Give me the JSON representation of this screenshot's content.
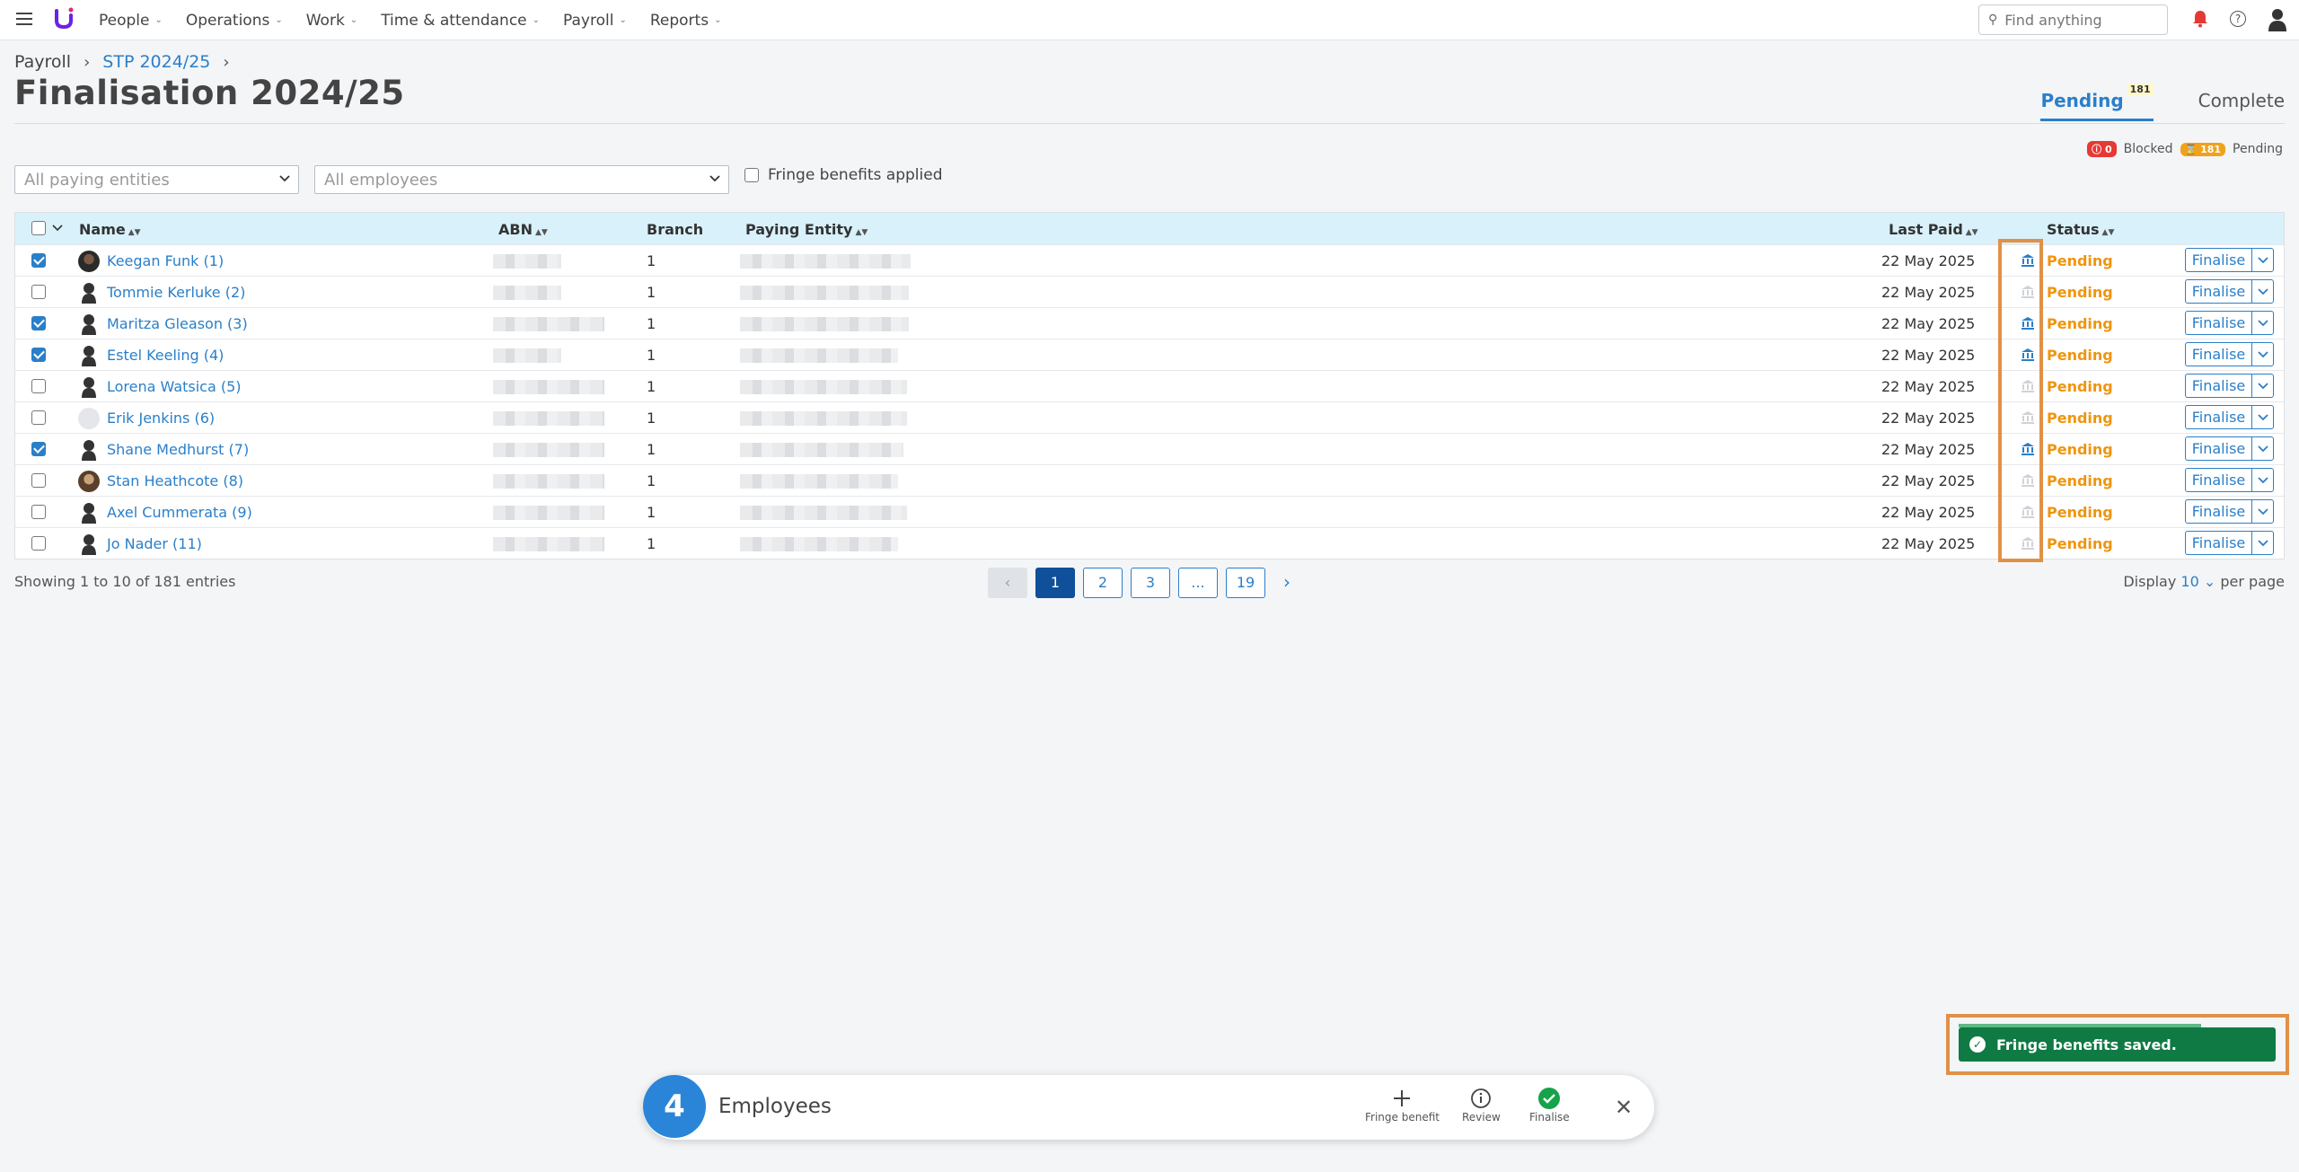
{
  "nav": {
    "items": [
      "People",
      "Operations",
      "Work",
      "Time & attendance",
      "Payroll",
      "Reports"
    ],
    "search_placeholder": "Find anything"
  },
  "breadcrumb": {
    "root": "Payroll",
    "current": "STP 2024/25"
  },
  "page_title": "Finalisation 2024/25",
  "tabs": [
    {
      "label": "Pending",
      "count": "181"
    },
    {
      "label": "Complete"
    }
  ],
  "legend": {
    "blocked_count": "0",
    "blocked_label": "Blocked",
    "pending_count": "181",
    "pending_label": "Pending"
  },
  "filters": {
    "entities_placeholder": "All paying entities",
    "employees_placeholder": "All employees",
    "fringe_label": "Fringe benefits applied"
  },
  "table": {
    "headers": {
      "name": "Name",
      "abn": "ABN",
      "branch": "Branch",
      "entity": "Paying Entity",
      "last_paid": "Last Paid",
      "status": "Status"
    },
    "rows": [
      {
        "name": "Keegan Funk (1)",
        "branch": "1",
        "last_paid": "22 May 2025",
        "status": "Pending",
        "checked": true,
        "fringe": true,
        "avatar": "photo"
      },
      {
        "name": "Tommie Kerluke (2)",
        "branch": "1",
        "last_paid": "22 May 2025",
        "status": "Pending",
        "checked": false,
        "fringe": false,
        "avatar": "silhouette"
      },
      {
        "name": "Maritza Gleason (3)",
        "branch": "1",
        "last_paid": "22 May 2025",
        "status": "Pending",
        "checked": true,
        "fringe": true,
        "avatar": "silhouette"
      },
      {
        "name": "Estel Keeling (4)",
        "branch": "1",
        "last_paid": "22 May 2025",
        "status": "Pending",
        "checked": true,
        "fringe": true,
        "avatar": "silhouette"
      },
      {
        "name": "Lorena Watsica (5)",
        "branch": "1",
        "last_paid": "22 May 2025",
        "status": "Pending",
        "checked": false,
        "fringe": false,
        "avatar": "silhouette"
      },
      {
        "name": "Erik Jenkins (6)",
        "branch": "1",
        "last_paid": "22 May 2025",
        "status": "Pending",
        "checked": false,
        "fringe": false,
        "avatar": "blank"
      },
      {
        "name": "Shane Medhurst (7)",
        "branch": "1",
        "last_paid": "22 May 2025",
        "status": "Pending",
        "checked": true,
        "fringe": true,
        "avatar": "silhouette"
      },
      {
        "name": "Stan Heathcote (8)",
        "branch": "1",
        "last_paid": "22 May 2025",
        "status": "Pending",
        "checked": false,
        "fringe": false,
        "avatar": "photo2"
      },
      {
        "name": "Axel Cummerata (9)",
        "branch": "1",
        "last_paid": "22 May 2025",
        "status": "Pending",
        "checked": false,
        "fringe": false,
        "avatar": "silhouette"
      },
      {
        "name": "Jo Nader (11)",
        "branch": "1",
        "last_paid": "22 May 2025",
        "status": "Pending",
        "checked": false,
        "fringe": false,
        "avatar": "silhouette"
      }
    ],
    "action_label": "Finalise"
  },
  "footer": {
    "showing": "Showing 1 to 10 of 181 entries",
    "pages": [
      "1",
      "2",
      "3",
      "...",
      "19"
    ],
    "display_prefix": "Display",
    "display_value": "10",
    "display_suffix": "per page"
  },
  "toast": {
    "message": "Fringe benefits saved."
  },
  "actionbar": {
    "count": "4",
    "label": "Employees",
    "actions": [
      "Fringe benefit",
      "Review",
      "Finalise"
    ]
  },
  "colors": {
    "accent": "#2a7fc9",
    "pending": "#f0950f",
    "success": "#0f7a43",
    "highlight": "#e09147"
  }
}
